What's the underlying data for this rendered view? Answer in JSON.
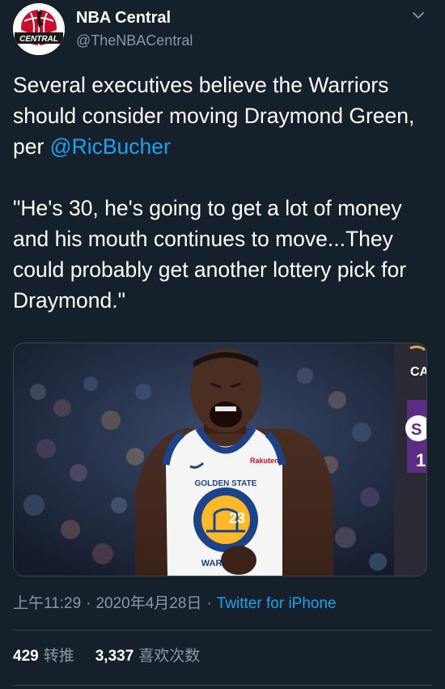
{
  "author": {
    "display_name": "NBA Central",
    "handle": "@TheNBACentral",
    "avatar_text": "CENTRAL"
  },
  "tweet": {
    "text_part1": "Several executives believe the Warriors should consider moving Draymond Green, per ",
    "mention": "@RicBucher",
    "text_part2": "\n\n\"He's 30, he's going to get a lot of money and his mouth continues to move...They could probably get another lottery pick for Draymond.\""
  },
  "media": {
    "jersey_sponsor": "Rakuten",
    "jersey_text": "GOLDEN STATE",
    "jersey_number": "23",
    "jersey_bottom": "WARRIORS",
    "sign_text_top": "CA",
    "sign_text_mid": "S",
    "sign_text_bottom": "1"
  },
  "meta": {
    "time": "上午11:29",
    "date": "2020年4月28日",
    "source": "Twitter for iPhone",
    "separator": "·"
  },
  "stats": {
    "retweets_count": "429",
    "retweets_label": "转推",
    "likes_count": "3,337",
    "likes_label": "喜欢次数"
  },
  "colors": {
    "background": "#15202b",
    "accent": "#1da1f2",
    "secondary_text": "#8899a6",
    "divider": "#38444d",
    "avatar_red": "#c8102e"
  },
  "icons": {
    "more_options": "chevron-down-icon"
  }
}
